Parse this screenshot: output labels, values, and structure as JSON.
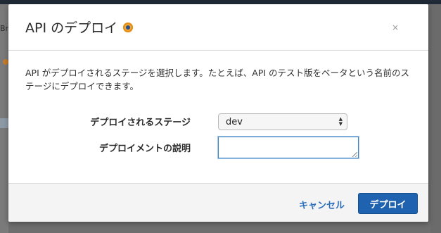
{
  "background": {
    "left_fragment": "Bre"
  },
  "dialog": {
    "title": "API のデプロイ",
    "close_label": "×",
    "description": "API がデプロイされるステージを選択します。たとえば、API のテスト版をベータという名前のステージにデプロイできます。",
    "fields": {
      "stage": {
        "label": "デプロイされるステージ",
        "selected_value": "dev"
      },
      "deployment_description": {
        "label": "デプロイメントの説明",
        "value": ""
      }
    },
    "buttons": {
      "cancel": "キャンセル",
      "deploy": "デプロイ"
    }
  }
}
